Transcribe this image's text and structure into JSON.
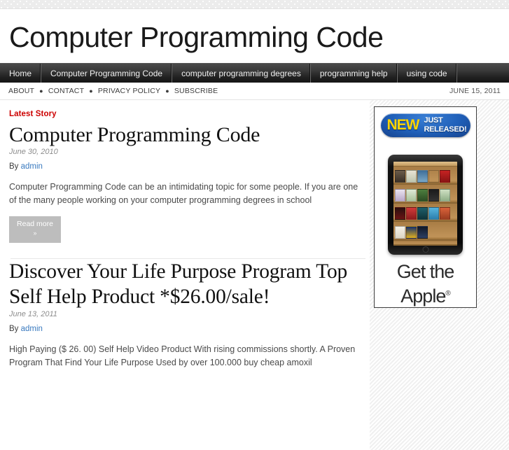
{
  "site": {
    "title": "Computer Programming Code"
  },
  "mainnav": {
    "items": [
      {
        "label": "Home"
      },
      {
        "label": "Computer Programming Code"
      },
      {
        "label": "computer programming degrees"
      },
      {
        "label": "programming help"
      },
      {
        "label": "using code"
      }
    ]
  },
  "subnav": {
    "links": [
      "ABOUT",
      "CONTACT",
      "PRIVACY POLICY",
      "SUBSCRIBE"
    ],
    "separator": "●",
    "date": "JUNE 15, 2011"
  },
  "content": {
    "latest_label": "Latest Story",
    "posts": [
      {
        "title": "Computer Programming Code",
        "date": "June 30, 2010",
        "by_prefix": "By",
        "author": "admin",
        "excerpt": "Computer Programming Code can be an intimidating topic for some people. If you are one of the many people working on your computer programming degrees in school",
        "read_more": "Read more",
        "read_more_sub": "»"
      },
      {
        "title": "Discover Your Life Purpose Program Top Self Help Product *$26.00/sale!",
        "date": "June 13, 2011",
        "by_prefix": "By",
        "author": "admin",
        "excerpt": "High Paying ($ 26. 00) Self Help Video Product With rising commissions shortly. A Proven Program That Find Your Life Purpose Used by over 100.000 buy cheap amoxil"
      }
    ]
  },
  "sidebar": {
    "ad": {
      "badge_new": "NEW",
      "badge_just": "JUST",
      "badge_released": "RELEASED!",
      "device_alt": "apple-ipad-bookshelf-image",
      "footer_line1": "Get the",
      "footer_line2": "Apple",
      "footer_registered": "®"
    }
  },
  "colors": {
    "accent_red": "#cc0000",
    "link_blue": "#3a7abf",
    "badge_blue": "#1f5fb8",
    "badge_yellow": "#ffd400",
    "nav_dark": "#222222"
  }
}
